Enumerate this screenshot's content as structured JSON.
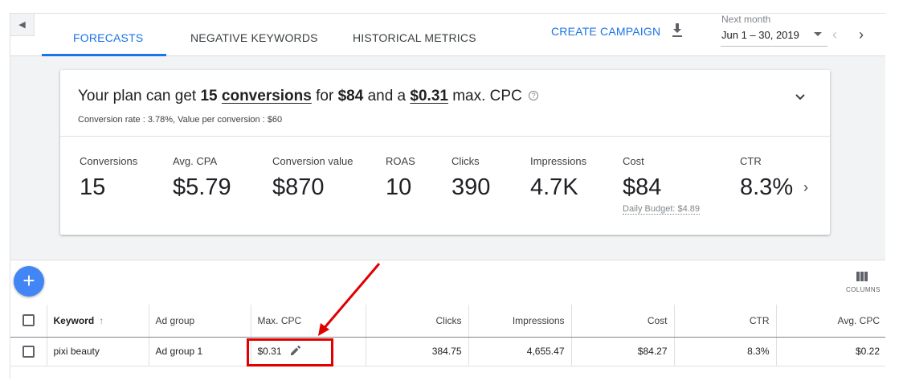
{
  "tabs": [
    {
      "label": "FORECASTS",
      "active": true
    },
    {
      "label": "NEGATIVE KEYWORDS",
      "active": false
    },
    {
      "label": "HISTORICAL METRICS",
      "active": false
    }
  ],
  "toolbar": {
    "create_campaign": "CREATE CAMPAIGN",
    "download_icon": "download-icon"
  },
  "date_range": {
    "label": "Next month",
    "value": "Jun 1 – 30, 2019"
  },
  "summary": {
    "prefix": "Your plan can get",
    "conversions_count": "15",
    "conversions_word": "conversions",
    "for_word": "for",
    "cost": "$84",
    "and_a": "and a",
    "max_cpc": "$0.31",
    "suffix": "max. CPC",
    "help_glyph": "?",
    "subline": "Conversion rate : 3.78%, Value per conversion : $60"
  },
  "metrics": [
    {
      "label": "Conversions",
      "value": "15"
    },
    {
      "label": "Avg. CPA",
      "value": "$5.79"
    },
    {
      "label": "Conversion value",
      "value": "$870"
    },
    {
      "label": "ROAS",
      "value": "10"
    },
    {
      "label": "Clicks",
      "value": "390"
    },
    {
      "label": "Impressions",
      "value": "4.7K"
    },
    {
      "label": "Cost",
      "value": "$84",
      "sub": "Daily Budget: $4.89"
    },
    {
      "label": "CTR",
      "value": "8.3%"
    }
  ],
  "table": {
    "columns_label": "COLUMNS",
    "headers": {
      "keyword": "Keyword",
      "ad_group": "Ad group",
      "max_cpc": "Max. CPC",
      "clicks": "Clicks",
      "impressions": "Impressions",
      "cost": "Cost",
      "ctr": "CTR",
      "avg_cpc": "Avg. CPC"
    },
    "rows": [
      {
        "keyword": "pixi beauty",
        "ad_group": "Ad group 1",
        "max_cpc": "$0.31",
        "clicks": "384.75",
        "impressions": "4,655.47",
        "cost": "$84.27",
        "ctr": "8.3%",
        "avg_cpc": "$0.22"
      }
    ]
  },
  "colors": {
    "accent": "#1a73e8",
    "fab": "#4285f4",
    "annotation": "#e00000"
  }
}
